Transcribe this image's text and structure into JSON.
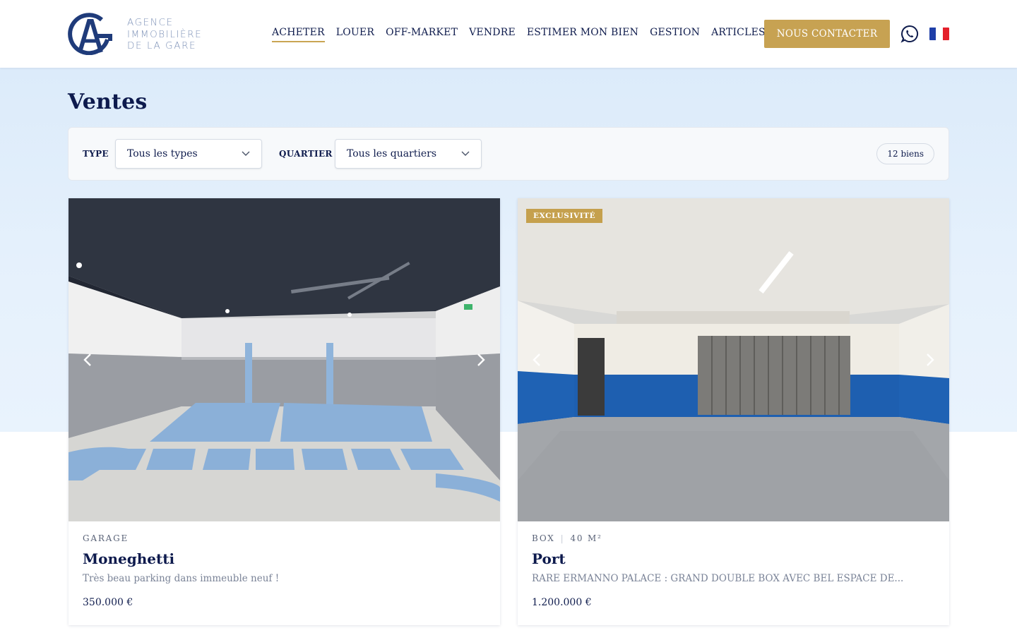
{
  "brand": {
    "logo_line1": "AGENCE",
    "logo_line2": "IMMOBILIÈRE",
    "logo_line3": "DE LA GARE",
    "primary_color": "#0f1c4d",
    "accent_color": "#c7a252"
  },
  "nav": {
    "items": [
      {
        "label": "ACHETER",
        "active": true
      },
      {
        "label": "LOUER",
        "active": false
      },
      {
        "label": "OFF-MARKET",
        "active": false
      },
      {
        "label": "VENDRE",
        "active": false
      },
      {
        "label": "ESTIMER MON BIEN",
        "active": false
      },
      {
        "label": "GESTION",
        "active": false
      },
      {
        "label": "ARTICLES",
        "active": false
      }
    ],
    "contact_label": "NOUS CONTACTER",
    "whatsapp_icon": "whatsapp-icon",
    "language_icon": "french-flag-icon"
  },
  "page": {
    "title": "Ventes"
  },
  "filters": {
    "type_label": "TYPE",
    "type_value": "Tous les types",
    "district_label": "QUARTIER",
    "district_value": "Tous les quartiers",
    "count": "12 biens"
  },
  "listings": [
    {
      "badge": "",
      "type": "GARAGE",
      "surface": "",
      "title": "Moneghetti",
      "description": "Très beau parking dans immeuble neuf !",
      "price": "350.000 €"
    },
    {
      "badge": "EXCLUSIVITÉ",
      "type": "BOX",
      "surface": "40 M²",
      "title": "Port",
      "description": "RARE ERMANNO PALACE : GRAND DOUBLE BOX AVEC BEL ESPACE DE...",
      "price": "1.200.000 €"
    }
  ]
}
